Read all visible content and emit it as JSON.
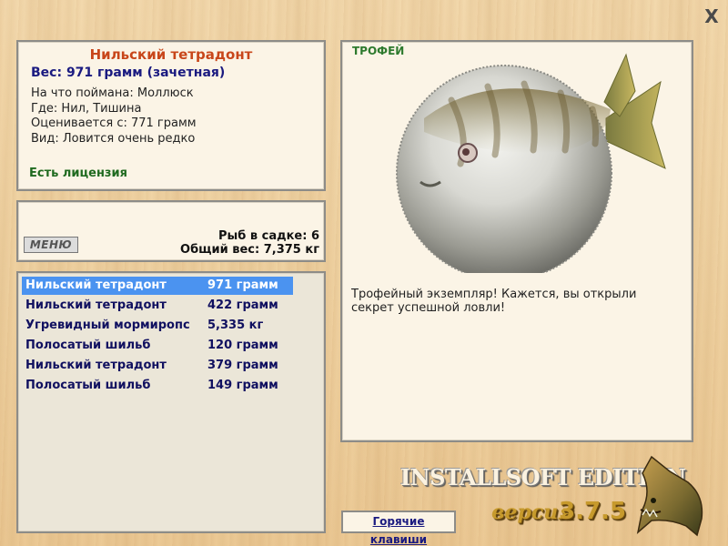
{
  "window": {
    "close_label": "X"
  },
  "fish_info": {
    "name": "Нильский тетрадонт",
    "weight_line": "Вес: 971 грамм (зачетная)",
    "lines": [
      "На что поймана: Моллюск",
      "Где: Нил, Тишина",
      "Оценивается с: 771 грамм",
      "Вид: Ловится очень редко"
    ],
    "license": "Есть лицензия"
  },
  "cage": {
    "menu_label": "МЕНЮ",
    "fish_count": "Рыб в садке: 6",
    "total_weight": "Общий вес: 7,375 кг"
  },
  "catch_list": [
    {
      "name": "Нильский тетрадонт",
      "weight": "971 грамм",
      "selected": true
    },
    {
      "name": "Нильский тетрадонт",
      "weight": "422 грамм",
      "selected": false
    },
    {
      "name": "Угревидный мормиропс",
      "weight": "5,335 кг",
      "selected": false
    },
    {
      "name": "Полосатый шильб",
      "weight": "120 грамм",
      "selected": false
    },
    {
      "name": "Нильский тетрадонт",
      "weight": "379 грамм",
      "selected": false
    },
    {
      "name": "Полосатый шильб",
      "weight": "149 грамм",
      "selected": false
    }
  ],
  "trophy": {
    "label": "ТРОФЕЙ",
    "message": "Трофейный экземпляр! Кажется, вы открыли секрет успешной ловли!"
  },
  "footer": {
    "hotkeys_label": "Горячие клавиши",
    "edition_title": "INSTALLSOFT EDITION",
    "version_word": "версия",
    "version_number": "3.7.5"
  },
  "colors": {
    "fish_name": "#c8461a",
    "weight_line": "#1a1a80",
    "license": "#1f6a1f",
    "selection": "#4b93f0",
    "trophy_label": "#2e7a2e"
  },
  "icons": {
    "close": "close-icon",
    "fish_image": "pufferfish-image",
    "logo": "pike-logo"
  }
}
